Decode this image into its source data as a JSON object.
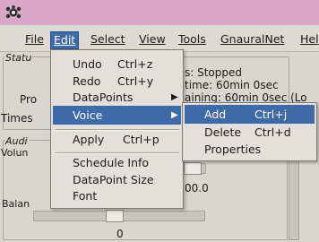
{
  "menubar": {
    "items": [
      {
        "label": "File"
      },
      {
        "label": "Edit"
      },
      {
        "label": "Select"
      },
      {
        "label": "View"
      },
      {
        "label": "Tools"
      },
      {
        "label": "GnauralNet"
      },
      {
        "label": "Hel"
      }
    ]
  },
  "background": {
    "status_frame_label": "Statu",
    "status_line1": "s: Stopped",
    "status_line2": "time: 60min 0sec",
    "status_line3": "aining: 60min 0sec (Lo",
    "left_label_pro": "Pro",
    "left_label_times": "Times",
    "audio_frame_label": "Audi",
    "volume_label": "Volun",
    "volume_value": "00.0",
    "balance_label": "Balan",
    "balance_value": "0"
  },
  "edit_menu": {
    "items": [
      {
        "label": "Undo",
        "accel": "Ctrl+z"
      },
      {
        "label": "Redo",
        "accel": "Ctrl+y"
      },
      {
        "label": "DataPoints",
        "accel": ""
      },
      {
        "label": "Voice",
        "accel": ""
      },
      {
        "label": "Apply",
        "accel": "Ctrl+p"
      },
      {
        "label": "Schedule Info",
        "accel": ""
      },
      {
        "label": "DataPoint Size",
        "accel": ""
      },
      {
        "label": "Font",
        "accel": ""
      }
    ],
    "highlighted": "Voice"
  },
  "voice_menu": {
    "items": [
      {
        "label": "Add",
        "accel": "Ctrl+j"
      },
      {
        "label": "Delete",
        "accel": "Ctrl+d"
      },
      {
        "label": "Properties",
        "accel": ""
      }
    ],
    "highlighted": "Add"
  },
  "colors": {
    "titlebar": "#d9a7c7",
    "highlight": "#3e6aa8",
    "menu_bg": "#e3e0db",
    "window_bg": "#d9d6d0"
  },
  "icons": [
    "app-icon",
    "submenu-arrow-icon"
  ]
}
